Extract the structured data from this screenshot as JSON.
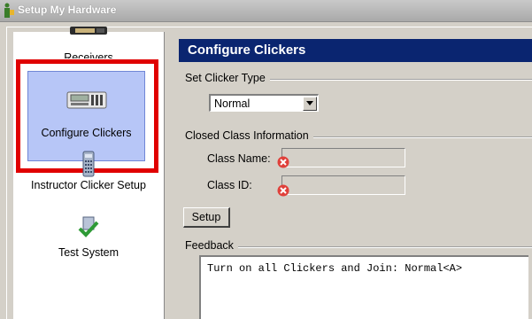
{
  "window": {
    "title": "Setup My Hardware"
  },
  "sidebar": {
    "items": [
      {
        "label": "Receivers",
        "icon": "receiver-icon"
      },
      {
        "label": "Configure Clickers",
        "icon": "clicker-base-icon",
        "selected": true
      },
      {
        "label": "Instructor Clicker Setup",
        "icon": "remote-icon"
      },
      {
        "label": "Test System",
        "icon": "checkmark-icon"
      }
    ]
  },
  "main": {
    "header": "Configure Clickers",
    "clicker_type": {
      "section": "Set Clicker Type",
      "selected": "Normal"
    },
    "class_info": {
      "section": "Closed Class Information",
      "class_name_label": "Class Name:",
      "class_name_value": "",
      "class_id_label": "Class ID:",
      "class_id_value": ""
    },
    "setup_button": "Setup",
    "feedback": {
      "section": "Feedback",
      "text": "Turn on all Clickers and Join: Normal<A>"
    }
  },
  "colors": {
    "header_bg": "#0a2570",
    "selected_bg": "#b7c6f7",
    "highlight_border": "#e00000",
    "error_icon": "#e0403a"
  }
}
